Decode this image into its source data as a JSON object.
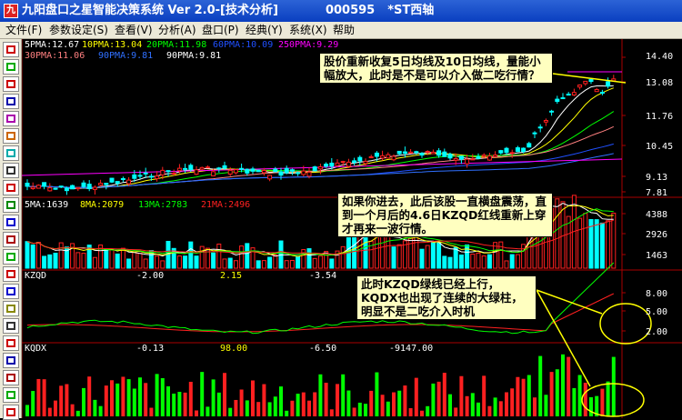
{
  "window": {
    "title": "九阳盘口之星智能决策系统 Ver 2.0-[技术分析]",
    "stock_code": "000595",
    "stock_name": "*ST西轴",
    "icon_text": "九"
  },
  "menu": [
    "文件(F)",
    "参数设定(S)",
    "查看(V)",
    "分析(A)",
    "盘口(P)",
    "经典(Y)",
    "系统(X)",
    "帮助"
  ],
  "toolbar_icons": [
    "kline-icon",
    "line-chart-icon",
    "indicator-icon",
    "bar-icon",
    "trend-icon",
    "compare-icon",
    "volume-icon",
    "window-icon",
    "tree-icon",
    "shield-icon",
    "calendar-icon",
    "grid-icon",
    "chart-icon",
    "data-icon",
    "stats-icon",
    "book-icon",
    "screen-icon",
    "list-icon",
    "menu-icon",
    "report-icon",
    "card-icon",
    "table-icon"
  ],
  "price_panel": {
    "ma_row1": [
      {
        "text": "5PMA:12.67",
        "color": "#ffffff"
      },
      {
        "text": "10PMA:13.04",
        "color": "#ffff00"
      },
      {
        "text": "20PMA:11.98",
        "color": "#00ff00"
      },
      {
        "text": "60PMA:10.09",
        "color": "#0000ff"
      },
      {
        "text": "250PMA:9.29",
        "color": "#ff00ff"
      }
    ],
    "ma_row2": [
      {
        "text": "30PMA:11.06",
        "color": "#ff8080"
      },
      {
        "text": "90PMA:9.81",
        "color": "#3070ff"
      },
      {
        "text": "90PMA:9.81",
        "color": "#ffffff"
      }
    ],
    "y_ticks": [
      "14.40",
      "13.08",
      "11.76",
      "10.45",
      "9.13",
      "7.81"
    ]
  },
  "volume_panel": {
    "ma_row": [
      {
        "text": "5MA:1639",
        "color": "#ffffff"
      },
      {
        "text": "8MA:2079",
        "color": "#ffff00"
      },
      {
        "text": "13MA:2783",
        "color": "#00ff00"
      },
      {
        "text": "21MA:2496",
        "color": "#ff2020"
      }
    ],
    "y_ticks": [
      "4388",
      "2926",
      "1463"
    ]
  },
  "kzqd_panel": {
    "title": "KZQD",
    "values": [
      {
        "text": "-2.00",
        "color": "#ffffff"
      },
      {
        "text": "2.15",
        "color": "#ffff00"
      },
      {
        "text": "-3.54",
        "color": "#ffffff"
      }
    ],
    "y_ticks": [
      "8.00",
      "5.00",
      "2.00"
    ]
  },
  "kqdx_panel": {
    "title": "KQDX",
    "values": [
      {
        "text": "-0.13",
        "color": "#ffffff"
      },
      {
        "text": "98.00",
        "color": "#ffff00"
      },
      {
        "text": "-6.50",
        "color": "#ffffff"
      },
      {
        "text": "-9147.00",
        "color": "#ffffff"
      }
    ]
  },
  "annotations": [
    "股价重新收复5日均线及10日均线，量能小幅放大，此时是不是可以介入做二吃行情？",
    "如果你进去，此后该股一直横盘震荡，直到一个月后的4.6日KZQD红线重新上穿才再来一波行情。",
    "此时KZQD绿线已经上行，KQDX也出现了连续的大绿柱，明显不是二吃介入时机"
  ]
}
